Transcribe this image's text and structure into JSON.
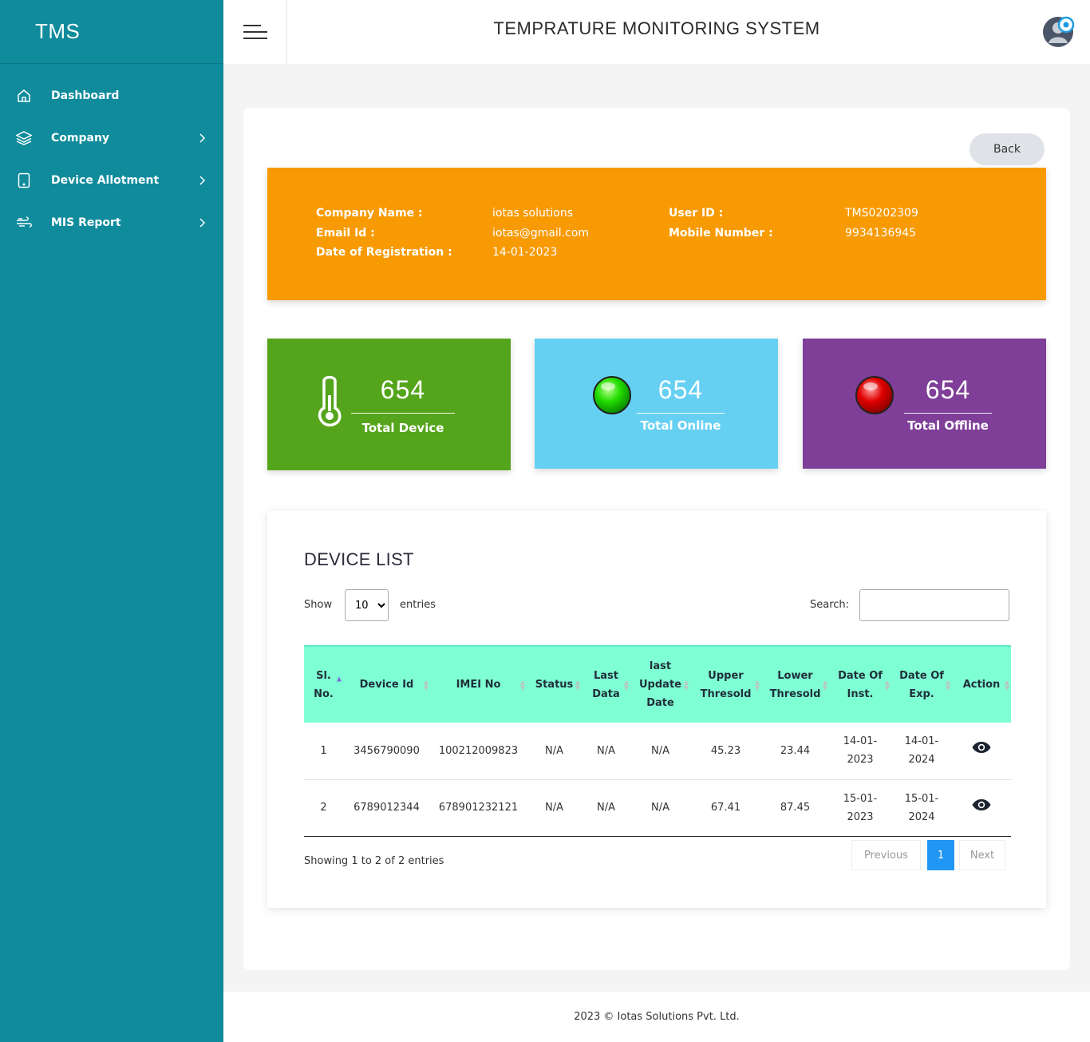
{
  "brand": "TMS",
  "sidebar": {
    "items": [
      {
        "label": "Dashboard",
        "icon": "home-icon"
      },
      {
        "label": "Company",
        "icon": "layers-icon"
      },
      {
        "label": "Device Allotment",
        "icon": "tablet-icon"
      },
      {
        "label": "MIS Report",
        "icon": "wind-icon"
      }
    ]
  },
  "header": {
    "title": "TEMPRATURE MONITORING SYSTEM"
  },
  "back_label": "Back",
  "company_info": {
    "company_name_label": "Company Name :",
    "company_name": "iotas solutions",
    "email_label": "Email Id :",
    "email": "iotas@gmail.com",
    "reg_date_label": "Date of Registration :",
    "reg_date": "14-01-2023",
    "user_id_label": "User ID :",
    "user_id": "TMS0202309",
    "mobile_label": "Mobile Number :",
    "mobile": "9934136945"
  },
  "stats": {
    "total_device": {
      "value": "654",
      "label": "Total Device",
      "color": "#55a51c"
    },
    "total_online": {
      "value": "654",
      "label": "Total Online",
      "color": "#66d0f2"
    },
    "total_offline": {
      "value": "654",
      "label": "Total Offline",
      "color": "#7f3f98"
    }
  },
  "device_list": {
    "title": "DEVICE LIST",
    "show_label": "Show",
    "entries_value": "10",
    "entries_label": "entries",
    "search_label": "Search:",
    "columns": [
      "Sl. No.",
      "Device Id",
      "IMEI No",
      "Status",
      "Last Data",
      "last Update Date",
      "Upper Thresold",
      "Lower Thresold",
      "Date Of Inst.",
      "Date Of Exp.",
      "Action"
    ],
    "rows": [
      {
        "sl": "1",
        "device_id": "3456790090",
        "imei": "100212009823",
        "status": "N/A",
        "last_data": "N/A",
        "last_update": "N/A",
        "upper": "45.23",
        "lower": "23.44",
        "inst": "14-01-2023",
        "exp": "14-01-2024"
      },
      {
        "sl": "2",
        "device_id": "6789012344",
        "imei": "678901232121",
        "status": "N/A",
        "last_data": "N/A",
        "last_update": "N/A",
        "upper": "67.41",
        "lower": "87.45",
        "inst": "15-01-2023",
        "exp": "15-01-2024"
      }
    ],
    "showing": "Showing 1 to 2 of 2 entries",
    "pagination": {
      "previous": "Previous",
      "current": "1",
      "next": "Next"
    }
  },
  "footer": "2023 © Iotas Solutions Pvt. Ltd."
}
